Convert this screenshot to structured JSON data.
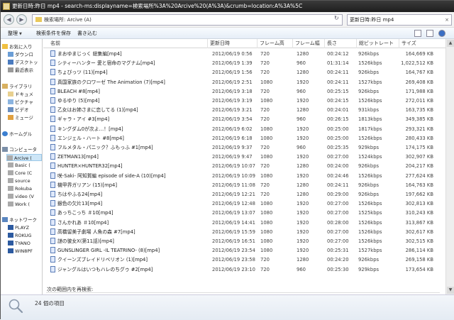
{
  "title": "更新日時:昨日 mp4 - search-ms:displayname=検索場所%3A%20Arcive%20(A%3A)&crumb=location:A%3A%5C",
  "address": "検索場所: Arcive (A)",
  "search_value": "更新日時:昨日 mp4",
  "toolbar": {
    "organize": "整理",
    "save_search": "検索条件を保存",
    "burn": "書き込む"
  },
  "nav": {
    "favorites": [
      "お気に入り",
      "ダウンロ",
      "デスクトッ",
      "最近表示"
    ],
    "libraries": [
      "ライブラリ",
      "ドキュメ",
      "ピクチャ",
      "ビデオ",
      "ミュージ"
    ],
    "homegroup": "ホームグル",
    "computer": [
      "コンピュータ",
      "Arcive (",
      "Basic (",
      "Core (C",
      "source",
      "Rokuba",
      "video (V",
      "Work ("
    ],
    "network": [
      "ネットワーク",
      "PLAYZ",
      "ROKUG",
      "TYANO",
      "WIN8PF"
    ]
  },
  "columns": [
    "名前",
    "更新日時",
    "フレーム高",
    "フレーム幅",
    "長さ",
    "総ビットレート",
    "サイズ"
  ],
  "files": [
    {
      "name": "まおゆまじっく 総集編[mp4]",
      "date": "2012/06/19 0:56",
      "fh": "720",
      "fw": "1280",
      "len": "00:24:12",
      "br": "926kbps",
      "size": "164,669 KB"
    },
    {
      "name": "シティーハンター 愛と宿命のマグナム[mp4]",
      "date": "2012/06/19 1:39",
      "fh": "720",
      "fw": "960",
      "len": "01:31:14",
      "br": "1526kbps",
      "size": "1,022,512 KB"
    },
    {
      "name": "ちょびっツ (11)[mp4]",
      "date": "2012/06/19 1:56",
      "fh": "720",
      "fw": "1280",
      "len": "00:24:11",
      "br": "926kbps",
      "size": "164,767 KB"
    },
    {
      "name": "真国家族のクロワーゼ The Animation (7)[mp4]",
      "date": "2012/06/19 2:51",
      "fh": "1080",
      "fw": "1920",
      "len": "00:24:11",
      "br": "1527kbps",
      "size": "269,408 KB"
    },
    {
      "name": "BLEACH #8[mp4]",
      "date": "2012/06/19 3:18",
      "fh": "720",
      "fw": "960",
      "len": "00:25:15",
      "br": "926kbps",
      "size": "171,988 KB"
    },
    {
      "name": "ゆるゆり (5)[mp4]",
      "date": "2012/06/19 3:19",
      "fh": "1080",
      "fw": "1920",
      "len": "00:24:15",
      "br": "1526kbps",
      "size": "272,011 KB"
    },
    {
      "name": "乙女はお姉さまに恋してる (1)[mp4]",
      "date": "2012/06/19 3:21",
      "fh": "720",
      "fw": "1280",
      "len": "00:24:01",
      "br": "931kbps",
      "size": "163,735 KB"
    },
    {
      "name": "ギャラ・アイ #3[mp4]",
      "date": "2012/06/19 3:54",
      "fh": "720",
      "fw": "960",
      "len": "00:26:15",
      "br": "1813kbps",
      "size": "349,385 KB"
    },
    {
      "name": "キングダム0が次よ…！[mp4]",
      "date": "2012/06/19 6:02",
      "fh": "1080",
      "fw": "1920",
      "len": "00:25:00",
      "br": "1817kbps",
      "size": "293,321 KB"
    },
    {
      "name": "エンジェル・ハート #8[mp4]",
      "date": "2012/06/19 6:18",
      "fh": "1080",
      "fw": "1920",
      "len": "00:25:00",
      "br": "1526kbps",
      "size": "280,433 KB"
    },
    {
      "name": "フルメタル・パニック？ふもっふ #1[mp4]",
      "date": "2012/06/19 9:37",
      "fh": "720",
      "fw": "960",
      "len": "00:25:35",
      "br": "929kbps",
      "size": "174,175 KB"
    },
    {
      "name": "ZETMAN13[mp4]",
      "date": "2012/06/19 9:47",
      "fh": "1080",
      "fw": "1920",
      "len": "00:27:00",
      "br": "1524kbps",
      "size": "302,907 KB"
    },
    {
      "name": "HUNTER×HUNTER32[mp4]",
      "date": "2012/06/19 10:07",
      "fh": "720",
      "fw": "1280",
      "len": "00:24:00",
      "br": "926kbps",
      "size": "204,217 KB"
    },
    {
      "name": "咲-Saki- 阿知賀編 episode of side-A (10)[mp4]",
      "date": "2012/06/19 10:09",
      "fh": "1080",
      "fw": "1920",
      "len": "00:24:46",
      "br": "1526kbps",
      "size": "277,624 KB"
    },
    {
      "name": "機甲界ガリアン (15)[mp4]",
      "date": "2012/06/19 11:08",
      "fh": "720",
      "fw": "1280",
      "len": "00:24:11",
      "br": "926kbps",
      "size": "164,763 KB"
    },
    {
      "name": "ちはやふる24[mp4]",
      "date": "2012/06/19 12:21",
      "fh": "720",
      "fw": "1280",
      "len": "00:29:00",
      "br": "926kbps",
      "size": "197,662 KB"
    },
    {
      "name": "銀色の欠片13[mp4]",
      "date": "2012/06/19 12:48",
      "fh": "1080",
      "fw": "1920",
      "len": "00:27:00",
      "br": "1526kbps",
      "size": "302,813 KB"
    },
    {
      "name": "あっちこっち ＃10[mp4]",
      "date": "2012/06/19 13:07",
      "fh": "1080",
      "fw": "1920",
      "len": "00:27:00",
      "br": "1525kbps",
      "size": "310,243 KB"
    },
    {
      "name": "さんかれあ ＃10[mp4]",
      "date": "2012/06/19 14:41",
      "fh": "1080",
      "fw": "1920",
      "len": "00:28:00",
      "br": "1526kbps",
      "size": "313,867 KB"
    },
    {
      "name": "高橋留美子劇場 人魚の森 #7[mp4]",
      "date": "2012/06/19 15:59",
      "fh": "1080",
      "fw": "1920",
      "len": "00:27:00",
      "br": "1526kbps",
      "size": "302,617 KB"
    },
    {
      "name": "謎の彼女X(第11話)[mp4]",
      "date": "2012/06/19 16:51",
      "fh": "1080",
      "fw": "1920",
      "len": "00:27:00",
      "br": "1526kbps",
      "size": "302,515 KB"
    },
    {
      "name": "GUNSLINGER GIRL -IL TEATRINO- (8)[mp4]",
      "date": "2012/06/19 23:54",
      "fh": "1080",
      "fw": "1920",
      "len": "00:25:31",
      "br": "1527kbps",
      "size": "286,114 KB"
    },
    {
      "name": "クイーンズブレイドリベリオン (1)[mp4]",
      "date": "2012/06/19 23:58",
      "fh": "720",
      "fw": "1280",
      "len": "00:24:20",
      "br": "926kbps",
      "size": "269,158 KB"
    },
    {
      "name": "ジャングルはいつもハレのちグゥ #2[mp4]",
      "date": "2012/06/19 23:10",
      "fh": "720",
      "fw": "960",
      "len": "00:25:30",
      "br": "929kbps",
      "size": "173,654 KB"
    }
  ],
  "research_label": "次の範囲内を再検索:",
  "status_count": "24 個の項目",
  "colors": {
    "titlebar": "#2b2b2b",
    "selection": "#cde6f7",
    "accent": "#3a6fc4"
  }
}
